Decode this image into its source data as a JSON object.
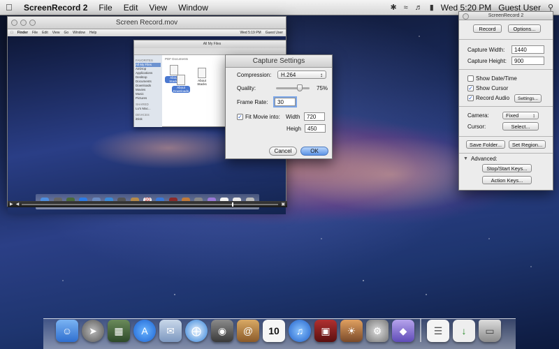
{
  "menubar": {
    "app_name": "ScreenRecord 2",
    "items": [
      "File",
      "Edit",
      "View",
      "Window"
    ],
    "clock": "Wed 5:20 PM",
    "user": "Guest User"
  },
  "movie_window": {
    "title": "Screen Record.mov",
    "mini_menubar": {
      "items": [
        "Finder",
        "File",
        "Edit",
        "View",
        "Go",
        "Window",
        "Help"
      ],
      "clock": "Wed 5:19 PM",
      "user": "Guest User"
    },
    "finder": {
      "title": "All My Files",
      "sidebar_groups": [
        "FAVORITES",
        "SHARED",
        "DEVICES"
      ],
      "sidebar_items": [
        "All My Files",
        "AirDrop",
        "Applications",
        "Desktop",
        "Documents",
        "Downloads",
        "Movies",
        "Music",
        "Pictures"
      ],
      "shared_item": "Lu's Mac...",
      "device_item": "iDisk",
      "section_label": "PDF Documents",
      "files": [
        "About Stacks",
        "About Downloads",
        "About Stacks"
      ]
    }
  },
  "capture_settings": {
    "title": "Capture Settings",
    "compression_label": "Compression:",
    "compression_value": "H.264",
    "quality_label": "Quality:",
    "quality_value": "75%",
    "frame_rate_label": "Frame Rate:",
    "frame_rate_value": "30",
    "fit_movie_label": "Fit Movie into:",
    "width_label": "Width",
    "width_value": "720",
    "height_label": "Heigh",
    "height_value": "450",
    "cancel_label": "Cancel",
    "ok_label": "OK"
  },
  "panel": {
    "title": "ScreenRecord 2",
    "record_label": "Record",
    "options_label": "Options...",
    "capture_width_label": "Capture Width:",
    "capture_width_value": "1440",
    "capture_height_label": "Capture Height:",
    "capture_height_value": "900",
    "show_date_label": "Show Date/Time",
    "show_cursor_label": "Show Cursor",
    "record_audio_label": "Record Audio",
    "settings_label": "Settings...",
    "camera_label": "Camera:",
    "camera_value": "Fixed",
    "cursor_label": "Cursor:",
    "select_label": "Select...",
    "save_folder_label": "Save Folder...",
    "set_region_label": "Set Region...",
    "advanced_label": "Advanced:",
    "stop_start_label": "Stop/Start Keys...",
    "action_keys_label": "Action Keys..."
  },
  "dock": {
    "calendar_day": "10",
    "icons": [
      "finder-icon",
      "launchpad-icon",
      "mission-control-icon",
      "app-store-icon",
      "mail-icon",
      "safari-icon",
      "facetime-icon",
      "address-book-icon",
      "ical-icon",
      "itunes-icon",
      "photo-booth-icon",
      "iphoto-icon",
      "system-preferences-icon",
      "preview-icon",
      "document-icon",
      "downloads-icon",
      "trash-icon"
    ]
  },
  "colors": {
    "accent": "#4a78d0",
    "default_button": "#5b93e6"
  }
}
